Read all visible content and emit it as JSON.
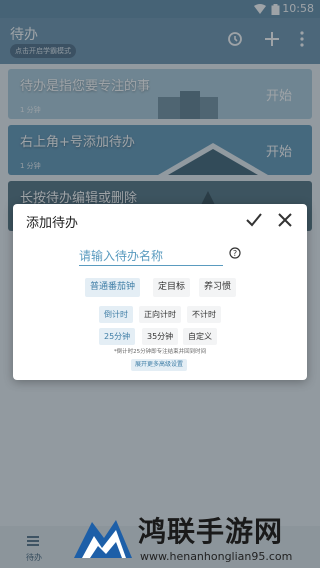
{
  "status_bar": {
    "time": "10:58"
  },
  "app_bar": {
    "title": "待办",
    "mode_chip": "点击开启学霸模式",
    "icons": [
      "alarm-clock-icon",
      "plus-icon",
      "more-vert-icon"
    ]
  },
  "todos": [
    {
      "name": "待办是指您要专注的事",
      "duration": "1 分钟",
      "action": "开始",
      "color": "#a9c8d8"
    },
    {
      "name": "右上角+号添加待办",
      "duration": "1 分钟",
      "action": "开始",
      "color": "#5f94b4"
    },
    {
      "name": "长按待办编辑或删除",
      "duration": "",
      "action": "",
      "color": "#4f6f7f"
    }
  ],
  "dialog": {
    "title": "添加待办",
    "name_placeholder": "请输入待办名称",
    "type_options": [
      "普通番茄钟",
      "定目标",
      "养习惯"
    ],
    "timer_options": [
      "倒计时",
      "正向计时",
      "不计时"
    ],
    "duration_options": [
      "25分钟",
      "35分钟",
      "自定义"
    ],
    "note": "*倒计时25分钟即专注结束并回到时间",
    "advanced_label": "展开更多高级设置",
    "accent_color": "#3f7ea6"
  },
  "bottom_nav": {
    "label": "待办"
  },
  "watermark": {
    "title": "鸿联手游网",
    "url": "www.henanhonglian95.com"
  }
}
